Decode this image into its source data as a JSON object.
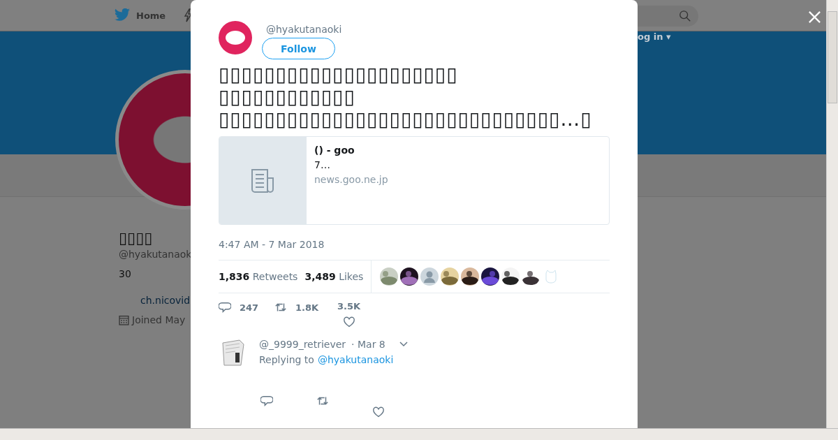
{
  "background": {
    "nav": {
      "home": "Home",
      "login": "og in ▾"
    },
    "profile": {
      "name": "▯▯▯▯",
      "handle": "@hyakutanaok",
      "bio": "30",
      "link": "ch.nicovid",
      "joined": "Joined May"
    }
  },
  "modal": {
    "handle": "@hyakutanaoki",
    "follow": "Follow",
    "text": [
      "▯▯▯▯▯▯▯▯▯▯▯▯▯▯▯▯▯▯▯▯▯",
      "▯▯▯▯▯▯▯▯▯▯▯▯",
      "▯▯▯▯▯▯▯▯▯▯▯▯▯▯▯▯▯▯▯▯▯▯▯▯▯▯▯▯▯▯…▯"
    ],
    "card": {
      "title": "() - goo",
      "description": "7…",
      "domain": "news.goo.ne.jp"
    },
    "time": "4:47 AM - 7 Mar 2018",
    "stats": [
      {
        "count": "1,836",
        "label": "Retweets"
      },
      {
        "count": "3,489",
        "label": "Likes"
      }
    ],
    "likers": [
      {
        "kind": "picture"
      },
      {
        "kind": "picture"
      },
      {
        "kind": "default"
      },
      {
        "kind": "picture"
      },
      {
        "kind": "picture"
      },
      {
        "kind": "picture"
      },
      {
        "kind": "picture"
      },
      {
        "kind": "picture"
      },
      {
        "kind": "faint"
      }
    ],
    "actions": [
      {
        "kind": "reply",
        "count": "247"
      },
      {
        "kind": "retweet",
        "count": "1.8K"
      },
      {
        "kind": "like",
        "count": "3.5K"
      }
    ],
    "reply": {
      "handle": "@_9999_retriever",
      "date": "· Mar 8",
      "replying": "Replying to",
      "to": "@hyakutanaoki"
    }
  }
}
